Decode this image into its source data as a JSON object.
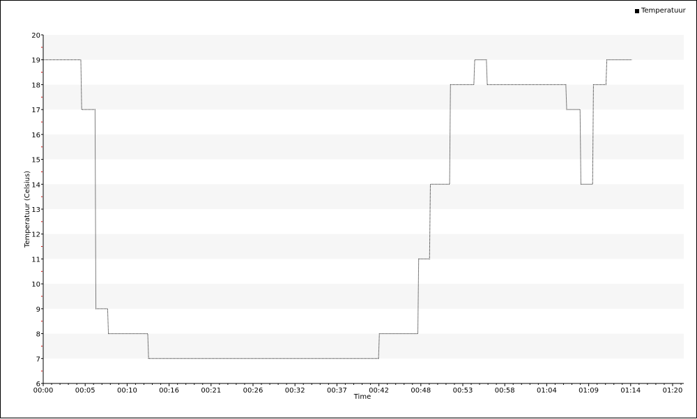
{
  "chart_data": {
    "type": "line",
    "title": "",
    "xlabel": "Time",
    "ylabel": "Temperatuur (Celsius)",
    "ylim": [
      6,
      20
    ],
    "y_ticks": [
      "6",
      "7",
      "8",
      "9",
      "10",
      "11",
      "12",
      "13",
      "14",
      "15",
      "16",
      "17",
      "18",
      "19",
      "20"
    ],
    "x_ticks": [
      "00:00",
      "00:05",
      "00:10",
      "00:16",
      "00:21",
      "00:26",
      "00:32",
      "00:37",
      "00:42",
      "00:48",
      "00:53",
      "00:58",
      "01:04",
      "01:09",
      "01:14",
      "01:20"
    ],
    "x_unit": "minutes",
    "xlim": [
      0,
      76.6
    ],
    "legend": "top-right",
    "grid": "alternating horizontal bands",
    "series": [
      {
        "name": "Temperatuur",
        "color": "#000000",
        "style": "dotted-step",
        "x": [
          0,
          4.5,
          6.2,
          7.7,
          12.5,
          40.1,
          44.8,
          46.2,
          48.6,
          51.5,
          53.0,
          62.5,
          64.2,
          65.7,
          67.3,
          68.8,
          70.3
        ],
        "y": [
          19,
          17,
          9,
          8,
          7,
          8,
          11,
          14,
          18,
          19,
          18,
          17,
          14,
          18,
          19,
          19,
          19
        ]
      }
    ]
  }
}
